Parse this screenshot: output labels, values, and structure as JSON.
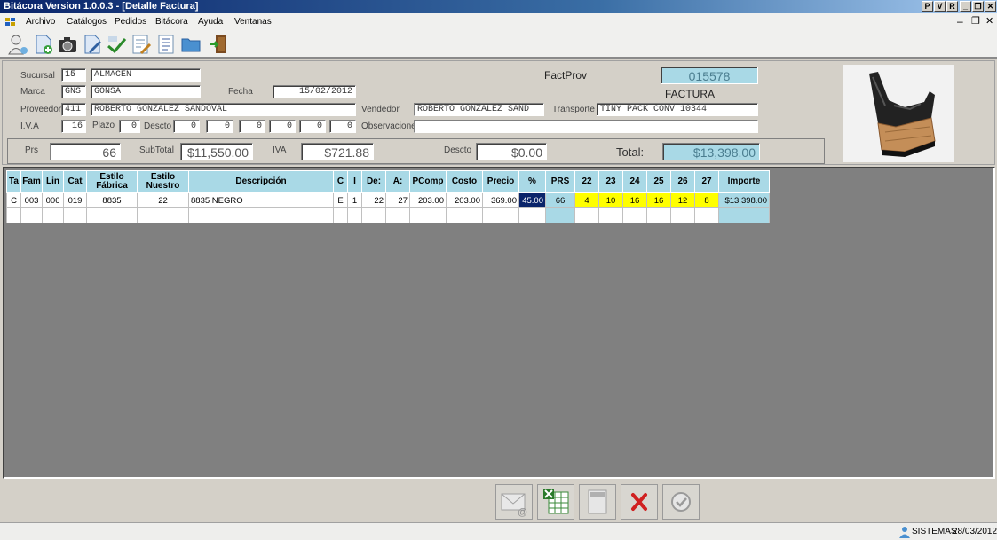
{
  "window": {
    "title": "Bitácora Version 1.0.0.3 - [Detalle Factura]",
    "top_buttons": [
      "P",
      "V",
      "R",
      "_",
      "❐",
      "✕"
    ],
    "child_buttons": [
      "–",
      "❐",
      "✕"
    ]
  },
  "menu": [
    "Archivo",
    "Catálogos",
    "Pedidos",
    "Bitácora",
    "Ayuda",
    "Ventanas"
  ],
  "toolbar_icons": [
    "user-icon",
    "new-document-icon",
    "camera-icon",
    "edit-document-icon",
    "download-icon",
    "edit-list-icon",
    "document-list-icon",
    "folder-icon",
    "exit-door-icon"
  ],
  "header": {
    "sucursal_label": "Sucursal",
    "sucursal_code": "15",
    "sucursal_name": "ALMACEN",
    "marca_label": "Marca",
    "marca_code": "GNS",
    "marca_name": "GONSA",
    "fecha_label": "Fecha",
    "fecha_value": "15/02/2012",
    "proveedor_label": "Proveedor",
    "proveedor_code": "411",
    "proveedor_name": "ROBERTO GONZALEZ SANDOVAL",
    "iva_label": "I.V.A",
    "iva_value": "16",
    "plazo_label": "Plazo",
    "plazo_value": "0",
    "descto_label": "Descto",
    "descto_values": [
      "0",
      "0",
      "0",
      "0",
      "0",
      "0"
    ],
    "factprov_label": "FactProv",
    "factprov_value": "015578",
    "doc_type": "FACTURA",
    "vendedor_label": "Vendedor",
    "vendedor_value": "ROBERTO GONZALEZ SAND",
    "transporte_label": "Transporte",
    "transporte_value": "TINY PACK CONV 10344",
    "observaciones_label": "Observaciones",
    "observaciones_value": ""
  },
  "totals": {
    "prs_label": "Prs",
    "prs_value": "66",
    "subtotal_label": "SubTotal",
    "subtotal_value": "$11,550.00",
    "iva_label": "IVA",
    "iva_value": "$721.88",
    "descto_label": "Descto",
    "descto_value": "$0.00",
    "total_label": "Total:",
    "total_value": "$13,398.00"
  },
  "table": {
    "headers": [
      "Ta",
      "Fam",
      "Lin",
      "Cat",
      "Estilo Fábrica",
      "Estilo Nuestro",
      "Descripción",
      "C",
      "I",
      "De:",
      "A:",
      "PComp",
      "Costo",
      "Precio",
      "%",
      "PRS",
      "22",
      "23",
      "24",
      "25",
      "26",
      "27",
      "Importe"
    ],
    "row": [
      "C",
      "003",
      "006",
      "019",
      "8835",
      "22",
      "8835 NEGRO",
      "E",
      "1",
      "22",
      "27",
      "203.00",
      "203.00",
      "369.00",
      "45.00",
      "66",
      "4",
      "10",
      "16",
      "16",
      "12",
      "8",
      "$13,398.00"
    ]
  },
  "status": {
    "user": "SISTEMAS",
    "date": "28/03/2012"
  }
}
